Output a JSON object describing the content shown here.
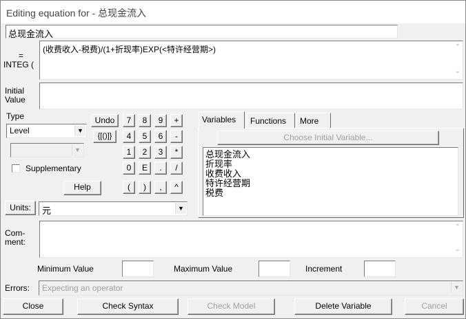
{
  "window": {
    "title": "Editing equation for - 总现金流入"
  },
  "variable_name": "总现金流入",
  "equation": {
    "label_line1": "=",
    "label_line2": "INTEG (",
    "value": "(收费收入-税费)/(1+折现率)EXP(<特许经营期>)"
  },
  "initial_value": {
    "label_line1": "Initial",
    "label_line2": "Value",
    "value": ""
  },
  "type": {
    "label": "Type",
    "selected": "Level",
    "sub_selected": ""
  },
  "supplementary": {
    "label": "Supplementary",
    "checked": false
  },
  "buttons": {
    "undo": "Undo",
    "brackets": "{[()]}",
    "help": "Help",
    "units": "Units:",
    "close": "Close",
    "check_syntax": "Check Syntax",
    "check_model": "Check Model",
    "delete_variable": "Delete Variable",
    "cancel": "Cancel",
    "choose_initial": "Choose Initial Variable..."
  },
  "keypad": {
    "row1": [
      "7",
      "8",
      "9",
      "+"
    ],
    "row2": [
      "4",
      "5",
      "6",
      "-"
    ],
    "row3": [
      "1",
      "2",
      "3",
      "*"
    ],
    "row4": [
      "0",
      "E",
      ".",
      "/"
    ],
    "row5": [
      "(",
      ")",
      ",",
      "^"
    ]
  },
  "tabs": [
    "Variables",
    "Functions",
    "More"
  ],
  "variables_list": [
    "总现金流入",
    "折现率",
    "收费收入",
    "特许经营期",
    "税费"
  ],
  "units": {
    "value": "元"
  },
  "comment": {
    "label_line1": "Com-",
    "label_line2": "ment:",
    "value": ""
  },
  "limits": {
    "min_label": "Minimum Value",
    "max_label": "Maximum Value",
    "inc_label": "Increment",
    "min_value": "",
    "max_value": "",
    "inc_value": ""
  },
  "errors": {
    "label": "Errors:",
    "message": "Expecting an operator"
  }
}
